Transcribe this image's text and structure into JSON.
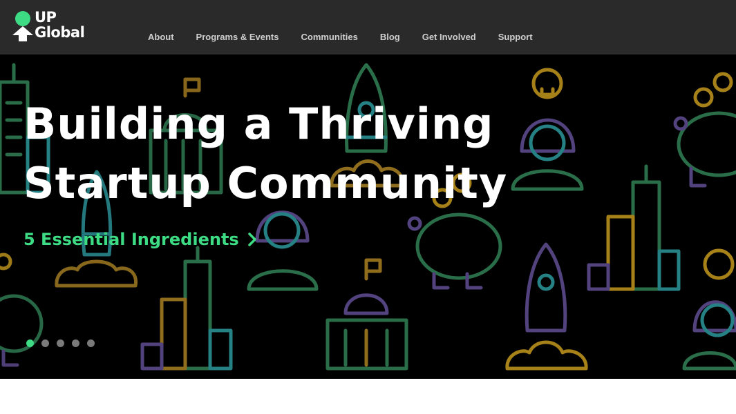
{
  "brand": {
    "logo_line1": "UP",
    "logo_line2": "Global",
    "accent_color": "#3ddc84"
  },
  "nav": {
    "items": [
      {
        "label": "About"
      },
      {
        "label": "Programs & Events"
      },
      {
        "label": "Communities"
      },
      {
        "label": "Blog"
      },
      {
        "label": "Get Involved"
      },
      {
        "label": "Support"
      }
    ]
  },
  "hero": {
    "title_line1": "Building a Thriving",
    "title_line2": "Startup Community",
    "cta_label": "5 Essential Ingredients",
    "cta_icon": "chevron-right-icon",
    "background_icons": [
      "skyscraper-icon",
      "rocket-icon",
      "capitol-building-icon",
      "lightbulb-person-icon",
      "piggy-bank-icon"
    ],
    "illustration_colors": [
      "#2f7a52",
      "#2a8f93",
      "#5b4a8b",
      "#b8901c",
      "#a07a22"
    ],
    "slider": {
      "slide_count": 5,
      "active_index": 0
    }
  }
}
